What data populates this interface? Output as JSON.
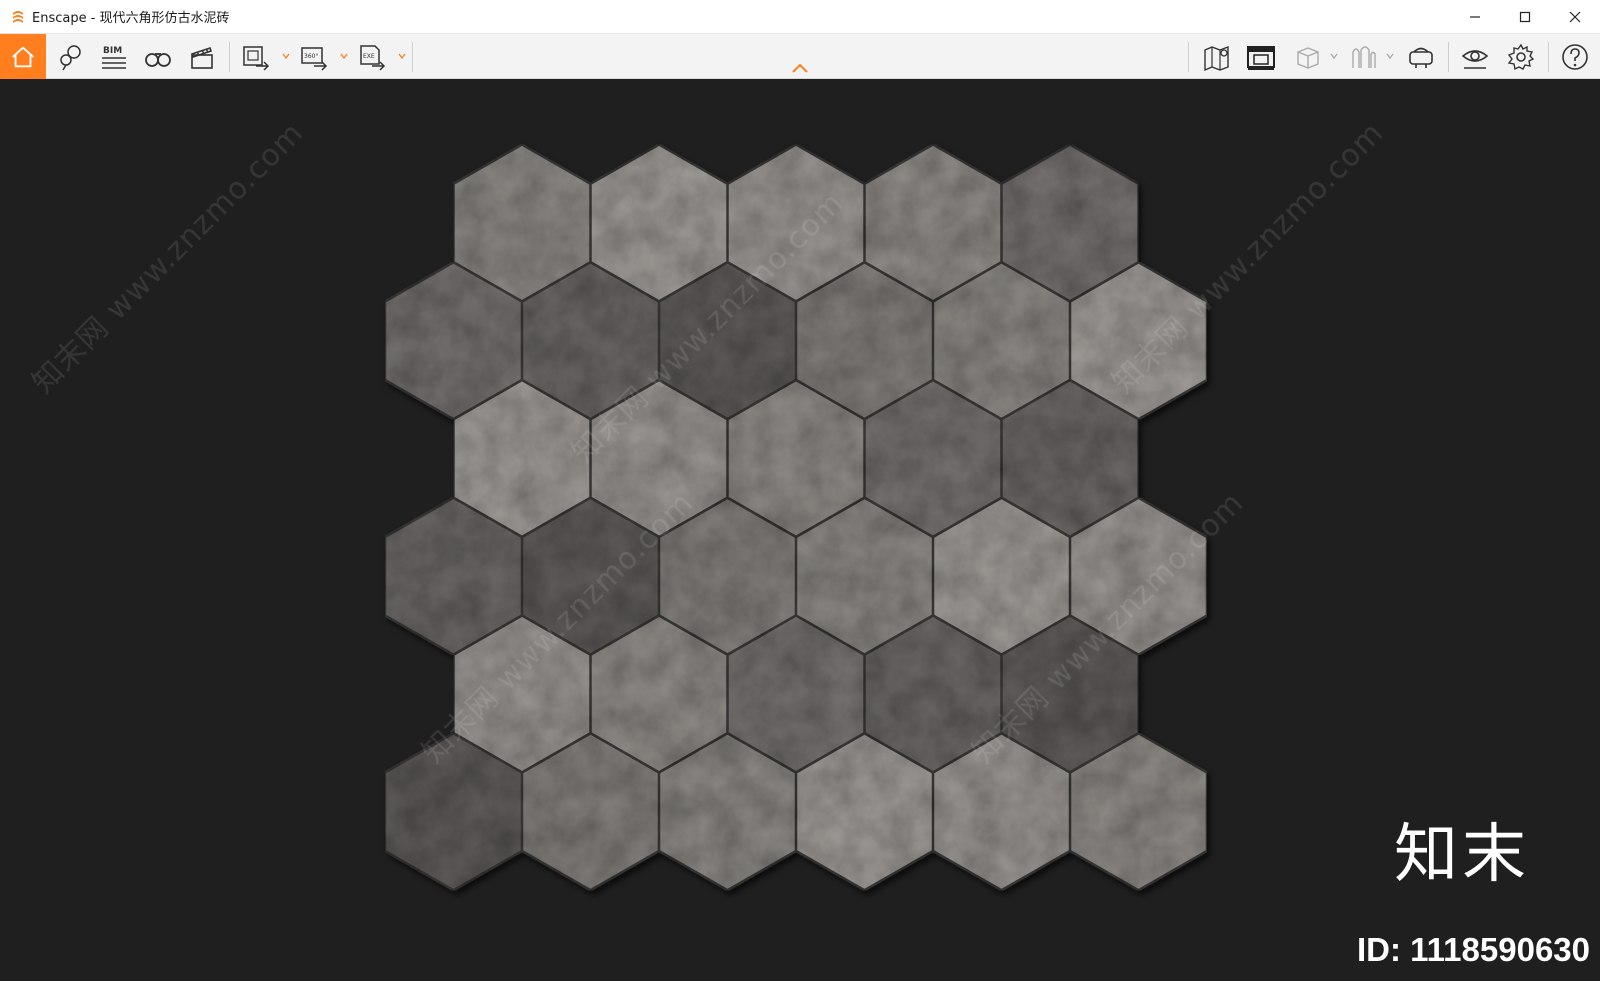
{
  "window": {
    "title": "Enscape - 现代六角形仿古水泥砖",
    "controls": {
      "minimize": "minimize",
      "maximize": "maximize",
      "close": "close"
    }
  },
  "toolbar": {
    "items": [
      {
        "name": "home",
        "icon": "home-icon",
        "active": true
      },
      {
        "name": "views",
        "icon": "location-pin-icon"
      },
      {
        "name": "bim",
        "icon": "bim-icon",
        "label": "BIM"
      },
      {
        "name": "orbit",
        "icon": "binoculars-icon"
      },
      {
        "name": "video",
        "icon": "clapperboard-icon"
      },
      {
        "name": "export-image",
        "icon": "export-image-icon"
      },
      {
        "name": "export-panorama",
        "icon": "export-360-icon",
        "label": "360°"
      },
      {
        "name": "export-exe",
        "icon": "export-exe-icon",
        "label": "EXE"
      },
      {
        "name": "map",
        "icon": "map-icon"
      },
      {
        "name": "gallery",
        "icon": "gallery-icon"
      },
      {
        "name": "material",
        "icon": "cube-icon"
      },
      {
        "name": "asset",
        "icon": "asset-icon"
      },
      {
        "name": "vr",
        "icon": "vr-headset-icon"
      },
      {
        "name": "visual",
        "icon": "eye-icon"
      },
      {
        "name": "settings",
        "icon": "gear-icon"
      },
      {
        "name": "help",
        "icon": "help-icon"
      }
    ],
    "accent": "#ff7f1f"
  },
  "viewport": {
    "background": "#1f1f1f",
    "watermark_text": "知末网 www.znzmo.com",
    "brand": "知末",
    "id_label": "ID: 1118590630"
  }
}
